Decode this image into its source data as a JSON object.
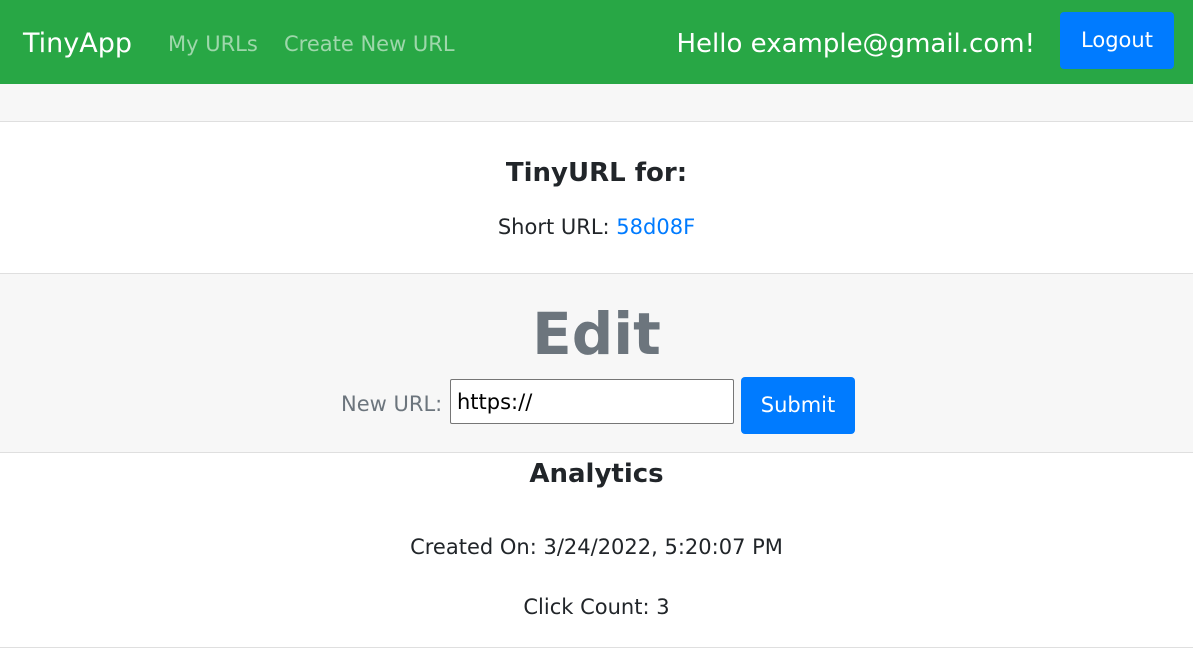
{
  "navbar": {
    "brand": "TinyApp",
    "links": [
      {
        "label": "My URLs"
      },
      {
        "label": "Create New URL"
      }
    ],
    "greeting": "Hello example@gmail.com!",
    "logout_label": "Logout"
  },
  "card": {
    "title": "TinyURL for:",
    "short_url_label": "Short URL:",
    "short_url_value": "58d08F"
  },
  "edit": {
    "title": "Edit",
    "new_url_label": "New URL:",
    "new_url_value": "https://",
    "submit_label": "Submit"
  },
  "analytics": {
    "title": "Analytics",
    "created_on": "Created On: 3/24/2022, 5:20:07 PM",
    "click_count": "Click Count: 3"
  },
  "colors": {
    "navbar_bg": "#28a745",
    "primary_button": "#007bff",
    "link": "#007bff",
    "muted_text": "#6c757d",
    "section_bg": "#f7f7f7"
  }
}
